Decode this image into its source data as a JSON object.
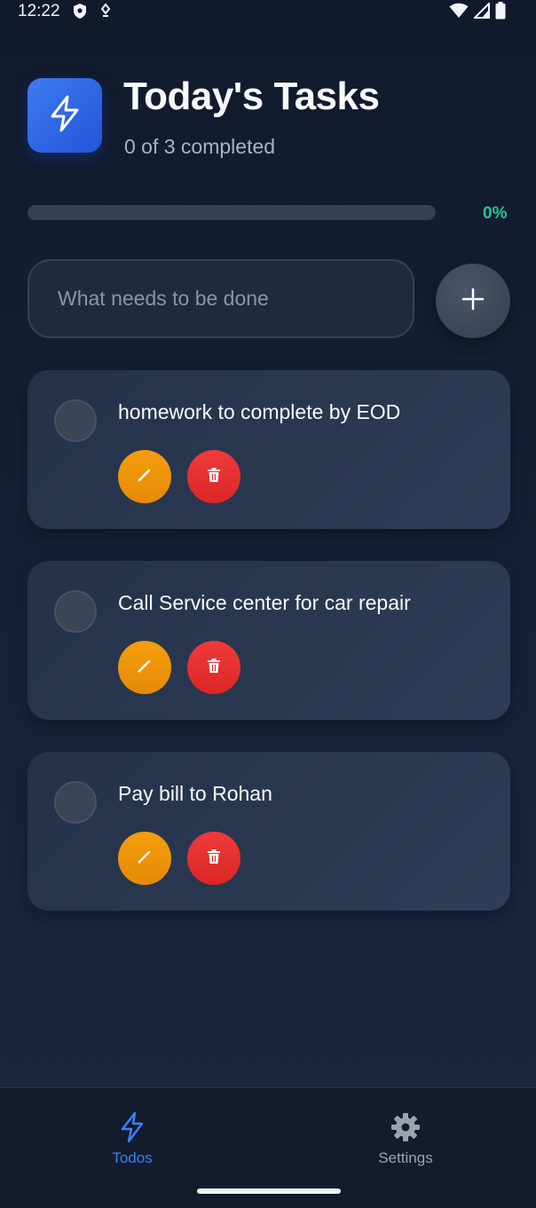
{
  "status_bar": {
    "time": "12:22",
    "icons": [
      "shield-icon",
      "signal-alt-icon",
      "wifi-icon",
      "cellular-icon",
      "battery-icon"
    ]
  },
  "header": {
    "logo_icon": "lightning-bolt-icon",
    "title": "Today's Tasks",
    "completed_text": "0 of 3 completed"
  },
  "progress": {
    "percent_label": "0%",
    "value": 0,
    "fill_color": "#10b981"
  },
  "new_task": {
    "placeholder": "What needs to be done",
    "value": "",
    "add_icon": "plus-icon"
  },
  "tasks": [
    {
      "text": "homework to complete by EOD",
      "completed": false
    },
    {
      "text": "Call Service center for car repair",
      "completed": false
    },
    {
      "text": "Pay bill to Rohan",
      "completed": false
    }
  ],
  "bottom_nav": {
    "todos_label": "Todos",
    "settings_label": "Settings",
    "active": "todos",
    "active_color": "#3b82f6"
  },
  "colors": {
    "edit": "#f59e0b",
    "delete": "#ef4444",
    "accent": "#3b82f6"
  }
}
